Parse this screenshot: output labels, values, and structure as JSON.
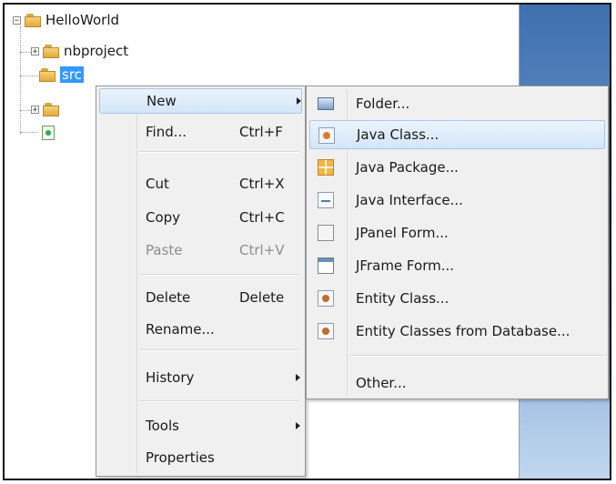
{
  "project_tree": {
    "root_label": "HelloWorld",
    "children": [
      {
        "label": "nbproject"
      },
      {
        "label": "src"
      }
    ]
  },
  "context_menu": {
    "items": [
      {
        "label": "New",
        "shortcut": "",
        "submenu": true
      },
      {
        "label": "Find...",
        "shortcut": "Ctrl+F"
      },
      {
        "label": "Cut",
        "shortcut": "Ctrl+X"
      },
      {
        "label": "Copy",
        "shortcut": "Ctrl+C"
      },
      {
        "label": "Paste",
        "shortcut": "Ctrl+V",
        "disabled": true
      },
      {
        "label": "Delete",
        "shortcut": "Delete"
      },
      {
        "label": "Rename...",
        "shortcut": ""
      },
      {
        "label": "History",
        "shortcut": "",
        "submenu": true
      },
      {
        "label": "Tools",
        "shortcut": "",
        "submenu": true
      },
      {
        "label": "Properties",
        "shortcut": ""
      }
    ]
  },
  "new_submenu": {
    "items": [
      {
        "label": "Folder...",
        "icon": "folder-icon"
      },
      {
        "label": "Java Class...",
        "icon": "java-class-icon"
      },
      {
        "label": "Java Package...",
        "icon": "java-package-icon"
      },
      {
        "label": "Java Interface...",
        "icon": "java-interface-icon"
      },
      {
        "label": "JPanel Form...",
        "icon": "jpanel-form-icon"
      },
      {
        "label": "JFrame Form...",
        "icon": "jframe-form-icon"
      },
      {
        "label": "Entity Class...",
        "icon": "entity-class-icon"
      },
      {
        "label": "Entity Classes from Database...",
        "icon": "entity-classes-db-icon"
      },
      {
        "label": "Other...",
        "icon": ""
      }
    ]
  },
  "colors": {
    "selection": "#3399ff",
    "menu_background": "#f0f0f0",
    "highlight": "#d4e6f8"
  }
}
